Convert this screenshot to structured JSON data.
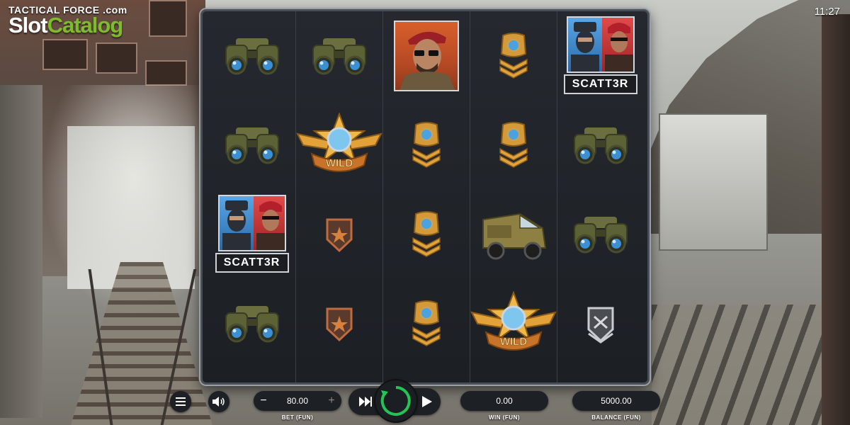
{
  "logo": {
    "top_text": "TACTICAL FORCE .com",
    "slot": "Slot",
    "catalog": "Catalog"
  },
  "clock": "11:27",
  "grid": {
    "columns": 5,
    "rows": 4,
    "reels": [
      [
        "binoculars",
        "binoculars",
        "scatter",
        "binoculars"
      ],
      [
        "binoculars",
        "wild",
        "rank-star",
        "rank-star"
      ],
      [
        "commander",
        "badge",
        "badge",
        "badge"
      ],
      [
        "badge",
        "badge",
        "armored-truck",
        "wild"
      ],
      [
        "scatter",
        "binoculars",
        "binoculars",
        "rank-grey"
      ]
    ],
    "scatter_label": "SCATT3R",
    "wild_label": "WILD"
  },
  "controls": {
    "bet_value": "80.00",
    "bet_minus": "−",
    "bet_plus": "+",
    "bet_caption": "BET (FUN)",
    "win_value": "0.00",
    "win_caption": "WIN (FUN)",
    "balance_value": "5000.00",
    "balance_caption": "BALANCE (FUN)"
  },
  "colors": {
    "brand_green": "#7dbd2d",
    "spin_ring": "#22c455",
    "board_bg": "#1c1f24"
  },
  "icons": [
    "menu-icon",
    "sound-icon",
    "fast-forward-icon",
    "spin-icon",
    "play-icon"
  ]
}
